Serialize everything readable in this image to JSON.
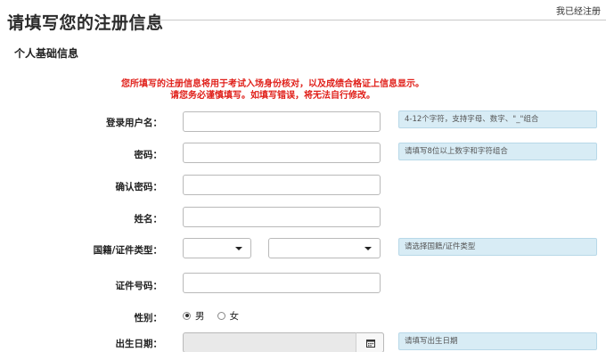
{
  "header": {
    "title": "请填写您的注册信息",
    "already_registered": "我已经注册"
  },
  "section": {
    "title": "个人基础信息"
  },
  "notice": {
    "line1": "您所填写的注册信息将用于考试入场身份核对，以及成绩合格证上信息显示。",
    "line2": "请您务必谨慎填写。如填写错误，将无法自行修改。"
  },
  "fields": {
    "username": {
      "label": "登录用户名：",
      "value": "",
      "hint": "4-12个字符，支持字母、数字、\"_\"组合"
    },
    "password": {
      "label": "密码：",
      "value": "",
      "hint": "请填写8位以上数字和字符组合"
    },
    "confirm_password": {
      "label": "确认密码：",
      "value": ""
    },
    "name": {
      "label": "姓名：",
      "value": ""
    },
    "nationality_id_type": {
      "label": "国籍/证件类型：",
      "nationality_selected": "",
      "id_type_selected": "",
      "hint": "请选择国籍/证件类型"
    },
    "id_number": {
      "label": "证件号码：",
      "value": ""
    },
    "gender": {
      "label": "性别：",
      "options": [
        "男",
        "女"
      ],
      "selected": "男"
    },
    "birth_date": {
      "label": "出生日期：",
      "value": "",
      "hint": "请填写出生日期"
    }
  },
  "icons": {
    "dropdown": "caret-down-icon",
    "calendar": "calendar-icon"
  },
  "colors": {
    "notice_text": "#e0201a",
    "hint_background": "#d8ecf5",
    "disabled_input": "#e9e9e9"
  }
}
